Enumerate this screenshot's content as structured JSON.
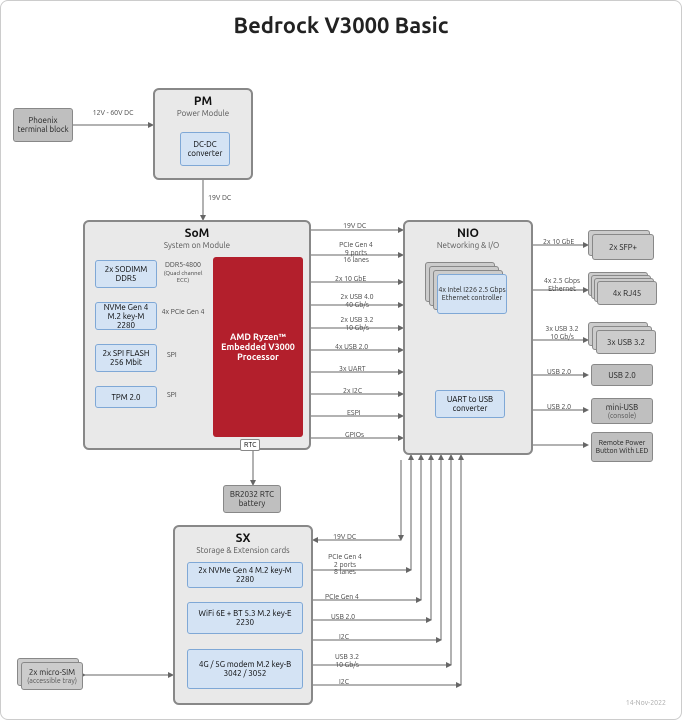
{
  "title": "Bedrock V3000 Basic",
  "date": "14-Nov-2022",
  "pm": {
    "title": "PM",
    "sub": "Power Module",
    "dcdc": "DC-DC converter"
  },
  "som": {
    "title": "SoM",
    "sub": "System on Module",
    "sodimm": "2x SODIMM DDR5",
    "ddr5": "DDR5-4800",
    "ddr5_sub": "(Quad channel ECC)",
    "nvme": "NVMe Gen 4 M.2 key-M 2280",
    "pcie4x": "4x PCIe Gen 4",
    "spiflash": "2x SPI FLASH 256 Mbit",
    "spi": "SPI",
    "tpm": "TPM 2.0",
    "proc": "AMD Ryzen™ Embedded V3000 Processor",
    "rtc": "RTC"
  },
  "nio": {
    "title": "NIO",
    "sub": "Networking & I/O",
    "eth": "4x Intel I226 2.5 Gbps Ethernet controller",
    "uart": "UART to USB converter"
  },
  "sx": {
    "title": "SX",
    "sub": "Storage & Extension cards",
    "nvme": "2x NVMe Gen 4 M.2 key-M 2280",
    "wifi": "WiFi 6E + BT 5.3 M.2 key-E 2230",
    "modem": "4G / 5G modem M.2 key-B 3042 / 3052"
  },
  "ext": {
    "phoenix": "Phoenix terminal block",
    "br2032": "BR2032 RTC battery",
    "sfp": "2x SFP+",
    "rj45": "4x RJ45",
    "usb32": "3x USB 3.2",
    "usb20": "USB 2.0",
    "mini": "mini-USB",
    "mini_sub": "(console)",
    "remote": "Remote Power Button With LED",
    "sim": "2x micro-SIM",
    "sim_sub": "(accessible tray)"
  },
  "lbl": {
    "v12": "12V - 60V DC",
    "v19": "19V DC",
    "pcie_9": "PCIe Gen 4\n9 ports\n16 lanes",
    "x10gbe": "2x 10 GbE",
    "usb40": "2x USB 4.0\n40 Gb/s",
    "usb32": "2x USB 3.2\n10 Gb/s",
    "usb20x4": "4x USB 2.0",
    "uart3": "3x UART",
    "i2c2": "2x I2C",
    "espi": "ESPI",
    "gpio": "GPIOs",
    "x10gbe2": "2x 10 GbE",
    "eth25": "4x 2.5 Gbps Ethernet",
    "usb32_3": "3x USB 3.2\n10 Gb/s",
    "usb20": "USB 2.0",
    "pcie_2": "PCIe Gen 4\n2 ports\n8 lanes",
    "pcie": "PCIe Gen 4",
    "i2c": "I2C",
    "usb32_1": "USB 3.2\n10 Gb/s"
  }
}
